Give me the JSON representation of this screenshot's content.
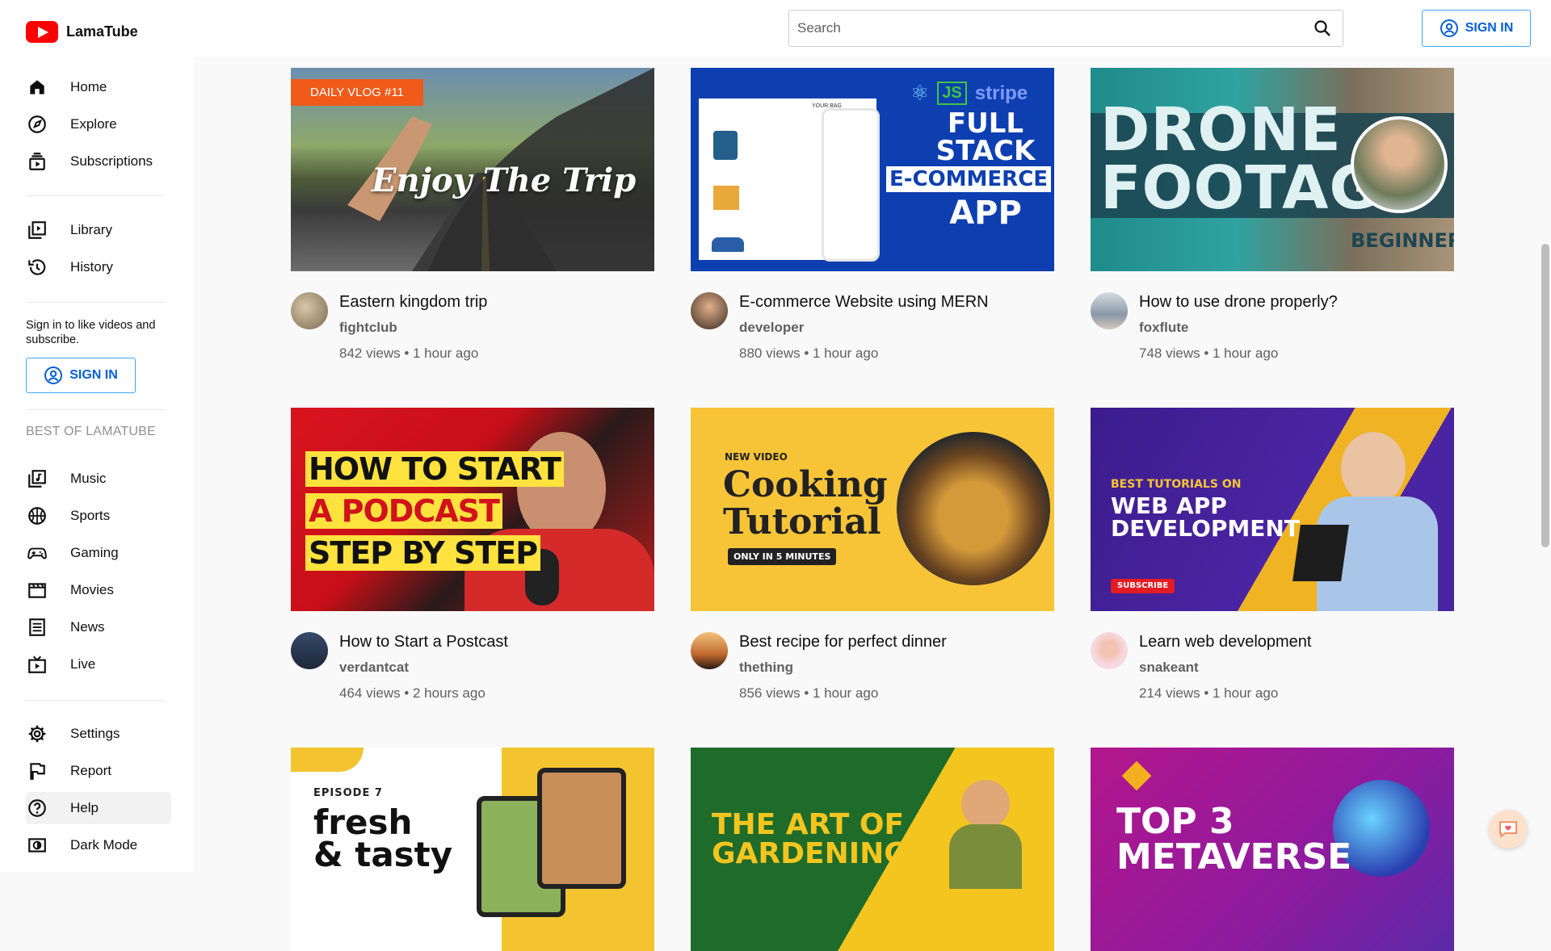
{
  "app": {
    "name": "LamaTube"
  },
  "colors": {
    "brand_red": "#ff0000",
    "link_blue": "#065fd4",
    "border_blue": "#3ea6ff",
    "muted": "#606060"
  },
  "sidebar": {
    "primary": [
      {
        "label": "Home",
        "icon": "home-icon"
      },
      {
        "label": "Explore",
        "icon": "explore-icon"
      },
      {
        "label": "Subscriptions",
        "icon": "subscriptions-icon"
      }
    ],
    "secondary": [
      {
        "label": "Library",
        "icon": "library-icon"
      },
      {
        "label": "History",
        "icon": "history-icon"
      }
    ],
    "signin_hint": "Sign in to like videos and subscribe.",
    "signin_label": "SIGN IN",
    "section_title": "BEST OF LAMATUBE",
    "categories": [
      {
        "label": "Music",
        "icon": "music-icon"
      },
      {
        "label": "Sports",
        "icon": "sports-icon"
      },
      {
        "label": "Gaming",
        "icon": "gaming-icon"
      },
      {
        "label": "Movies",
        "icon": "movies-icon"
      },
      {
        "label": "News",
        "icon": "news-icon"
      },
      {
        "label": "Live",
        "icon": "live-icon"
      }
    ],
    "bottom": [
      {
        "label": "Settings",
        "icon": "settings-icon"
      },
      {
        "label": "Report",
        "icon": "report-flag-icon"
      },
      {
        "label": "Help",
        "icon": "help-icon"
      },
      {
        "label": "Dark Mode",
        "icon": "dark-mode-icon"
      }
    ]
  },
  "header": {
    "search_placeholder": "Search",
    "signin_label": "SIGN IN"
  },
  "videos": [
    {
      "title": "Eastern kingdom trip",
      "channel": "fightclub",
      "info": "842 views • 1 hour ago",
      "thumb": {
        "badge": "DAILY VLOG #11",
        "text": "Enjoy The Trip"
      }
    },
    {
      "title": "E-commerce Website using MERN",
      "channel": "developer",
      "info": "880 views • 1 hour ago",
      "thumb": {
        "brand": "stripe",
        "js": "JS",
        "line1": "FULL",
        "line2": "STACK",
        "line3": "E-COMMERCE",
        "line4": "APP",
        "cart": "YOUR BAG"
      }
    },
    {
      "title": "How to use drone properly?",
      "channel": "foxflute",
      "info": "748 views • 1 hour ago",
      "thumb": {
        "line1": "DRONE",
        "line2": "FOOTAGE",
        "tag": "BEGINNER"
      }
    },
    {
      "title": "How to Start a Postcast",
      "channel": "verdantcat",
      "info": "464 views • 2 hours ago",
      "thumb": {
        "line1": "HOW TO START",
        "line2": "A PODCAST",
        "line3": "STEP BY STEP"
      }
    },
    {
      "title": "Best recipe for perfect dinner",
      "channel": "thething",
      "info": "856 views • 1 hour ago",
      "thumb": {
        "kicker": "NEW VIDEO",
        "line1": "Cooking",
        "line2": "Tutorial",
        "tag": "ONLY IN 5 MINUTES"
      }
    },
    {
      "title": "Learn web development",
      "channel": "snakeant",
      "info": "214 views • 1 hour ago",
      "thumb": {
        "kicker": "BEST TUTORIALS ON",
        "line1": "WEB APP",
        "line2": "DEVELOPMENT",
        "tag": "SUBSCRIBE"
      }
    },
    {
      "thumb": {
        "kicker": "EPISODE 7",
        "line1": "fresh",
        "line2": "& tasty"
      }
    },
    {
      "thumb": {
        "line1": "THE ART OF",
        "line2": "GARDENING"
      }
    },
    {
      "thumb": {
        "line1": "TOP 3",
        "line2": "METAVERSE"
      }
    }
  ]
}
